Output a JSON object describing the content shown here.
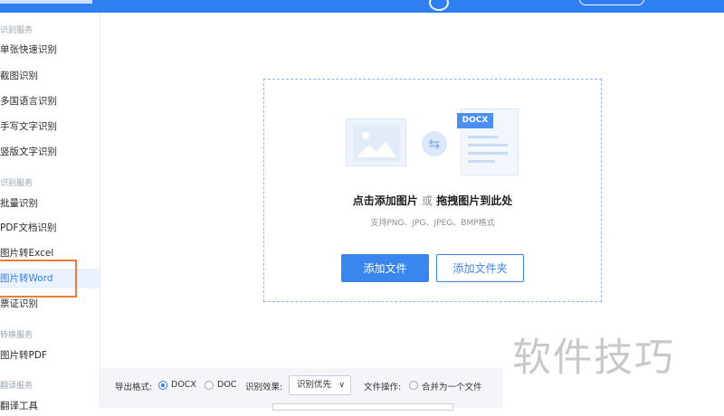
{
  "sidebar": {
    "sections": [
      {
        "label": "识别服务"
      },
      {
        "label": "识别服务"
      },
      {
        "label": "转换服务"
      },
      {
        "label": "翻译服务"
      }
    ],
    "items": [
      {
        "label": "单张快速识别"
      },
      {
        "label": "截图识别"
      },
      {
        "label": "多国语言识别"
      },
      {
        "label": "手写文字识别"
      },
      {
        "label": "竖版文字识别"
      },
      {
        "label": "批量识别"
      },
      {
        "label": "PDF文档识别"
      },
      {
        "label": "图片转Excel"
      },
      {
        "label": "图片转Word"
      },
      {
        "label": "票证识别"
      },
      {
        "label": "图片转PDF"
      },
      {
        "label": "翻译工具"
      }
    ]
  },
  "dropzone": {
    "doc_badge": "DOCX",
    "title_part1": "点击添加图片",
    "title_or": "或",
    "title_part2": "拖拽图片到此处",
    "subtitle": "支持PNG、JPG、JPEG、BMP格式",
    "add_file": "添加文件",
    "add_folder": "添加文件夹"
  },
  "bottom": {
    "format_label": "导出格式:",
    "docx": "DOCX",
    "doc": "DOC",
    "effect_label": "识别效果:",
    "effect_value": "识别优先",
    "file_op_label": "文件操作:",
    "merge": "合并为一个文件"
  },
  "watermark": "软件技巧",
  "colors": {
    "accent": "#2f7ff0",
    "highlight": "#f07a3c"
  }
}
